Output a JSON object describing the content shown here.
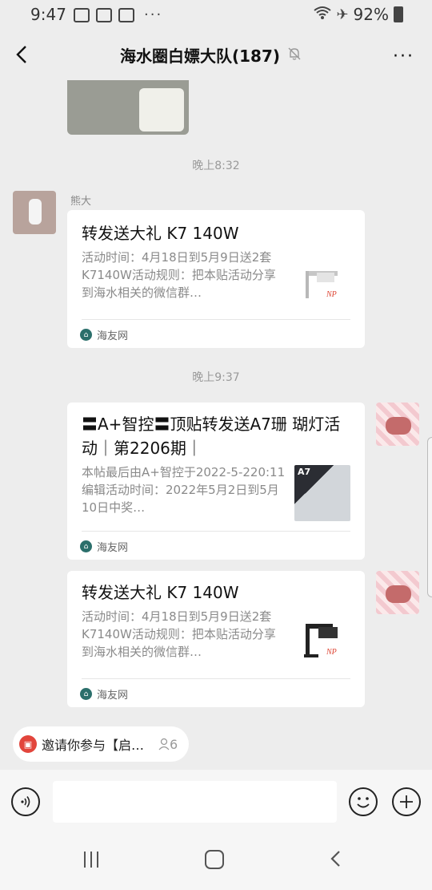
{
  "status_bar": {
    "time": "9:47",
    "battery": "92%",
    "dots": "···"
  },
  "header": {
    "title": "海水圈白嫖大队(187)",
    "back_icon": "chevron-left-icon",
    "mute_icon": "bell-off-icon",
    "more_icon": "more-dots-icon",
    "more_label": "···"
  },
  "messages": {
    "ts1": "晚上8:32",
    "ts2": "晚上9:37",
    "msg1": {
      "sender": "熊大",
      "title": "转发送大礼 K7 140W",
      "desc": "活动时间：4月18日到5月9日送2套K7140W活动规则：把本贴活动分享到海水相关的微信群…",
      "source": "海友网"
    },
    "msg2": {
      "title": "〓A+智控〓顶贴转发送A7珊 瑚灯活动｜第2206期｜",
      "desc": "本帖最后由A+智控于2022-5-220:11编辑活动时间：2022年5月2日到5月10日中奖…",
      "source": "海友网",
      "thumb_label": "A7"
    },
    "msg3": {
      "title": "转发送大礼 K7 140W",
      "desc": "活动时间：4月18日到5月9日送2套K7140W活动规则：把本贴活动分享到海水相关的微信群…",
      "source": "海友网"
    }
  },
  "pinned": {
    "text": "邀请你参与【启…",
    "count": "6"
  },
  "input": {
    "placeholder": ""
  },
  "colors": {
    "background": "#ededed",
    "card": "#ffffff",
    "source_icon": "#2b6f6b",
    "pinned_icon": "#e2453c"
  }
}
